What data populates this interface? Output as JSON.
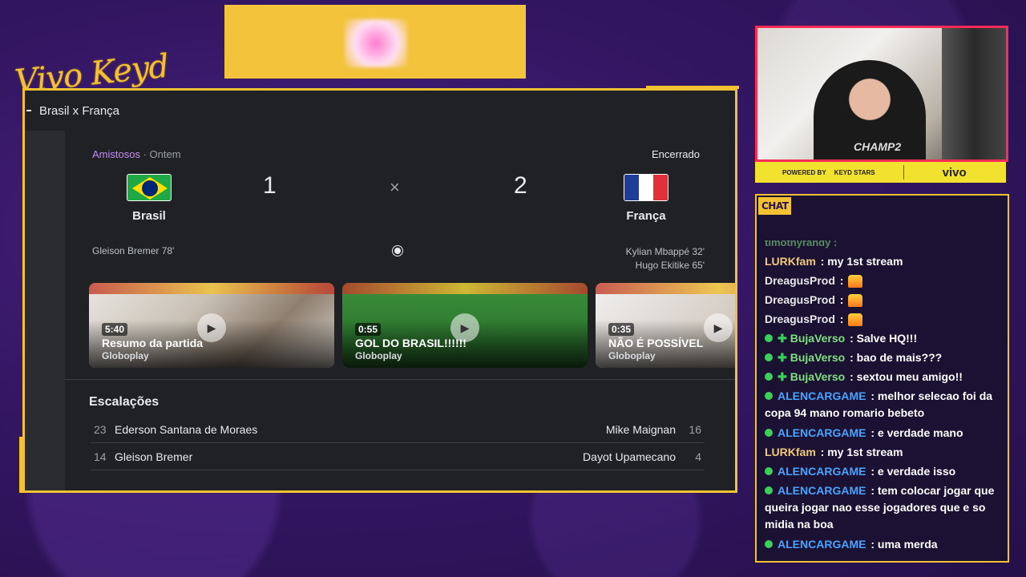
{
  "overlay": {
    "brand": "Vivo Keyd Stars"
  },
  "browser": {
    "title": "Brasil x França"
  },
  "match": {
    "league": "Amistosos",
    "when": "Ontem",
    "status": "Encerrado",
    "home": {
      "name": "Brasil",
      "score": "1",
      "scorers": "Gleison Bremer 78'"
    },
    "away": {
      "name": "França",
      "score": "2",
      "scorers": [
        "Kylian Mbappé 32'",
        "Hugo Ekitike 65'"
      ]
    },
    "separator": "×"
  },
  "videos": [
    {
      "duration": "5:40",
      "title": "Resumo da partida",
      "source": "Globoplay"
    },
    {
      "duration": "0:55",
      "title": "GOL DO BRASIL!!!!!!",
      "source": "Globoplay"
    },
    {
      "duration": "0:35",
      "title": "NÃO É POSSÍVEL",
      "source": "Globoplay"
    }
  ],
  "lineups": {
    "title": "Escalações",
    "rows": [
      {
        "home_num": "23",
        "home_name": "Ederson Santana de Moraes",
        "away_name": "Mike Maignan",
        "away_num": "16"
      },
      {
        "home_num": "14",
        "home_name": "Gleison Bremer",
        "away_name": "Dayot Upamecano",
        "away_num": "4"
      }
    ]
  },
  "webcam": {
    "shirt_text": "CHAMP2"
  },
  "sponsor": {
    "powered_by": "POWERED BY",
    "keyd": "KEYD STARS",
    "vivo": "vivo"
  },
  "chat": {
    "tag": "CHAT",
    "ghost": "timothyrandy :",
    "messages": [
      {
        "user": "LURKfam",
        "text": ": my 1st stream",
        "style": "lurk",
        "badge": "none"
      },
      {
        "user": "DreagusProd",
        "text": ":",
        "style": "dreagus",
        "badge": "fire"
      },
      {
        "user": "DreagusProd",
        "text": ":",
        "style": "dreagus",
        "badge": "fire"
      },
      {
        "user": "DreagusProd",
        "text": ":",
        "style": "dreagus",
        "badge": "fire"
      },
      {
        "user": "BujaVerso",
        "text": ": Salve HQ!!!",
        "style": "buja",
        "badge": "ok-plus"
      },
      {
        "user": "BujaVerso",
        "text": ": bao de mais???",
        "style": "buja",
        "badge": "ok-plus"
      },
      {
        "user": "BujaVerso",
        "text": ": sextou meu amigo!!",
        "style": "buja",
        "badge": "ok-plus"
      },
      {
        "user": "ALENCARGAME",
        "text": ": melhor selecao foi da copa 94 mano romario bebeto",
        "style": "alen",
        "badge": "ok"
      },
      {
        "user": "ALENCARGAME",
        "text": ": e verdade mano",
        "style": "alen",
        "badge": "ok"
      },
      {
        "user": "LURKfam",
        "text": ": my 1st stream",
        "style": "lurk",
        "badge": "none"
      },
      {
        "user": "ALENCARGAME",
        "text": ": e verdade isso",
        "style": "alen",
        "badge": "ok"
      },
      {
        "user": "ALENCARGAME",
        "text": ": tem colocar jogar que queira jogar nao esse jogadores que e so midia na boa",
        "style": "alen",
        "badge": "ok"
      },
      {
        "user": "ALENCARGAME",
        "text": ": uma merda",
        "style": "alen",
        "badge": "ok"
      }
    ]
  },
  "colors": {
    "accent": "#f2c233",
    "background": "#341664",
    "panel": "#202124",
    "webcam_border": "#ff2d55"
  }
}
